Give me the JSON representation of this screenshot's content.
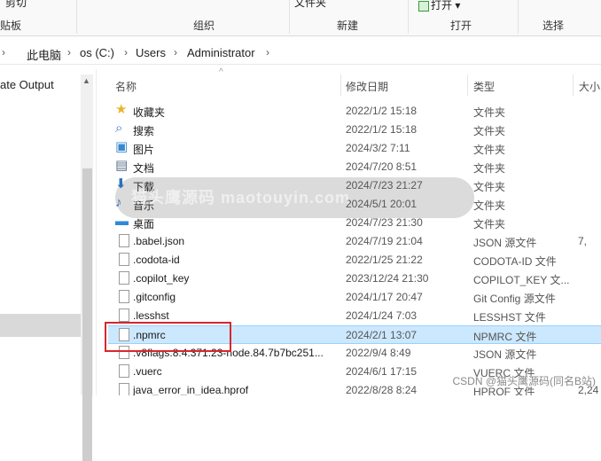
{
  "ribbon": {
    "cut": "剪切",
    "file_btn": "文件夹",
    "open_btn": "打开",
    "open_caret": "▾",
    "groups": {
      "clipboard": "贴板",
      "organize": "组织",
      "new": "新建",
      "open": "打开",
      "select": "选择"
    }
  },
  "address": {
    "crumbs": [
      "此电脑",
      "os (C:)",
      "Users",
      "Administrator"
    ]
  },
  "nav": {
    "item": "ate Output"
  },
  "columns": {
    "name": "名称",
    "date": "修改日期",
    "type": "类型",
    "size": "大小"
  },
  "rows": [
    {
      "name": "收藏夹",
      "date": "2022/1/2 15:18",
      "type": "文件夹",
      "size": "",
      "icon": "star-icon"
    },
    {
      "name": "搜索",
      "date": "2022/1/2 15:18",
      "type": "文件夹",
      "size": "",
      "icon": "magnifier-icon"
    },
    {
      "name": "图片",
      "date": "2024/3/2 7:11",
      "type": "文件夹",
      "size": "",
      "icon": "picture-icon"
    },
    {
      "name": "文档",
      "date": "2024/7/20 8:51",
      "type": "文件夹",
      "size": "",
      "icon": "document-icon"
    },
    {
      "name": "下载",
      "date": "2024/7/23 21:27",
      "type": "文件夹",
      "size": "",
      "icon": "download-arrow-icon"
    },
    {
      "name": "音乐",
      "date": "2024/5/1 20:01",
      "type": "文件夹",
      "size": "",
      "icon": "music-note-icon"
    },
    {
      "name": "桌面",
      "date": "2024/7/23 21:30",
      "type": "文件夹",
      "size": "",
      "icon": "desktop-icon"
    },
    {
      "name": ".babel.json",
      "date": "2024/7/19 21:04",
      "type": "JSON 源文件",
      "size": "7,",
      "icon": "file-icon"
    },
    {
      "name": ".codota-id",
      "date": "2022/1/25 21:22",
      "type": "CODOTA-ID 文件",
      "size": "",
      "icon": "file-icon"
    },
    {
      "name": ".copilot_key",
      "date": "2023/12/24 21:30",
      "type": "COPILOT_KEY 文...",
      "size": "",
      "icon": "file-icon"
    },
    {
      "name": ".gitconfig",
      "date": "2024/1/17 20:47",
      "type": "Git Config 源文件",
      "size": "",
      "icon": "file-icon"
    },
    {
      "name": ".lesshst",
      "date": "2024/1/24 7:03",
      "type": "LESSHST 文件",
      "size": "",
      "icon": "file-icon"
    },
    {
      "name": ".npmrc",
      "date": "2024/2/1 13:07",
      "type": "NPMRC 文件",
      "size": "",
      "icon": "file-icon",
      "selected": true
    },
    {
      "name": ".v8flags.8.4.371.23-node.84.7b7bc251...",
      "date": "2022/9/4 8:49",
      "type": "JSON 源文件",
      "size": "",
      "icon": "file-icon"
    },
    {
      "name": ".vuerc",
      "date": "2024/6/1 17:15",
      "type": "VUERC 文件",
      "size": "",
      "icon": "file-icon"
    },
    {
      "name": "java_error_in_idea.hprof",
      "date": "2022/8/28 8:24",
      "type": "HPROF 文件",
      "size": "2,24",
      "icon": "file-icon"
    }
  ],
  "overlay": {
    "watermark": "猫头鹰源码 maotouyin.com",
    "csdn": "CSDN @猫头鹰源码(同名B站)"
  },
  "colors": {
    "selection": "#cce8ff",
    "highlight_box": "#d9262c"
  }
}
